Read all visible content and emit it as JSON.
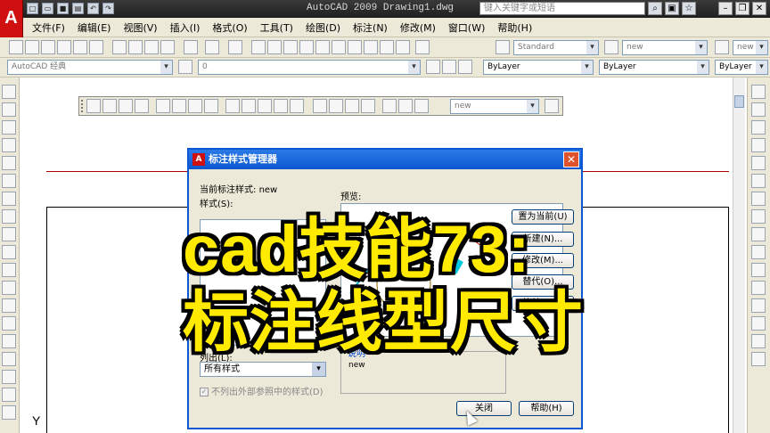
{
  "app": {
    "window_title": "AutoCAD 2009 Drawing1.dwg",
    "logo_glyph": "A",
    "search_placeholder": "键入关键字或短语"
  },
  "menu": [
    "文件(F)",
    "编辑(E)",
    "视图(V)",
    "插入(I)",
    "格式(O)",
    "工具(T)",
    "绘图(D)",
    "标注(N)",
    "修改(M)",
    "窗口(W)",
    "帮助(H)"
  ],
  "toolbar1": {
    "text_style": "Standard",
    "dim_style": "new",
    "table_style": "new"
  },
  "toolbar2": {
    "workspace": "AutoCAD 经典",
    "layer": "0",
    "color": "ByLayer",
    "linetype": "ByLayer",
    "lineweight": "ByLayer"
  },
  "dim_toolbar": {
    "style": "new"
  },
  "canvas": {
    "y_axis_label": "Y"
  },
  "dialog": {
    "title": "标注样式管理器",
    "current_style_label": "当前标注样式:",
    "current_style_value": "new",
    "styles_label": "样式(S):",
    "preview_label": "预览:",
    "list_label": "列出(L):",
    "list_value": "所有样式",
    "exclude_xref_label": "不列出外部参照中的样式(D)",
    "description_label": "说明",
    "description_value": "new",
    "buttons": {
      "set_current": "置为当前(U)",
      "new": "新建(N)...",
      "modify": "修改(M)...",
      "override": "替代(O)...",
      "compare": "比较(C)...",
      "close": "关闭",
      "help": "帮助(H)"
    }
  },
  "overlay": {
    "line1": "cad技能73:",
    "line2": "标注线型尺寸"
  },
  "colors": {
    "dialog_title": "#0c57d0",
    "caption_fill": "#ffea00",
    "caption_outline": "#000000",
    "app_logo": "#d01010"
  }
}
